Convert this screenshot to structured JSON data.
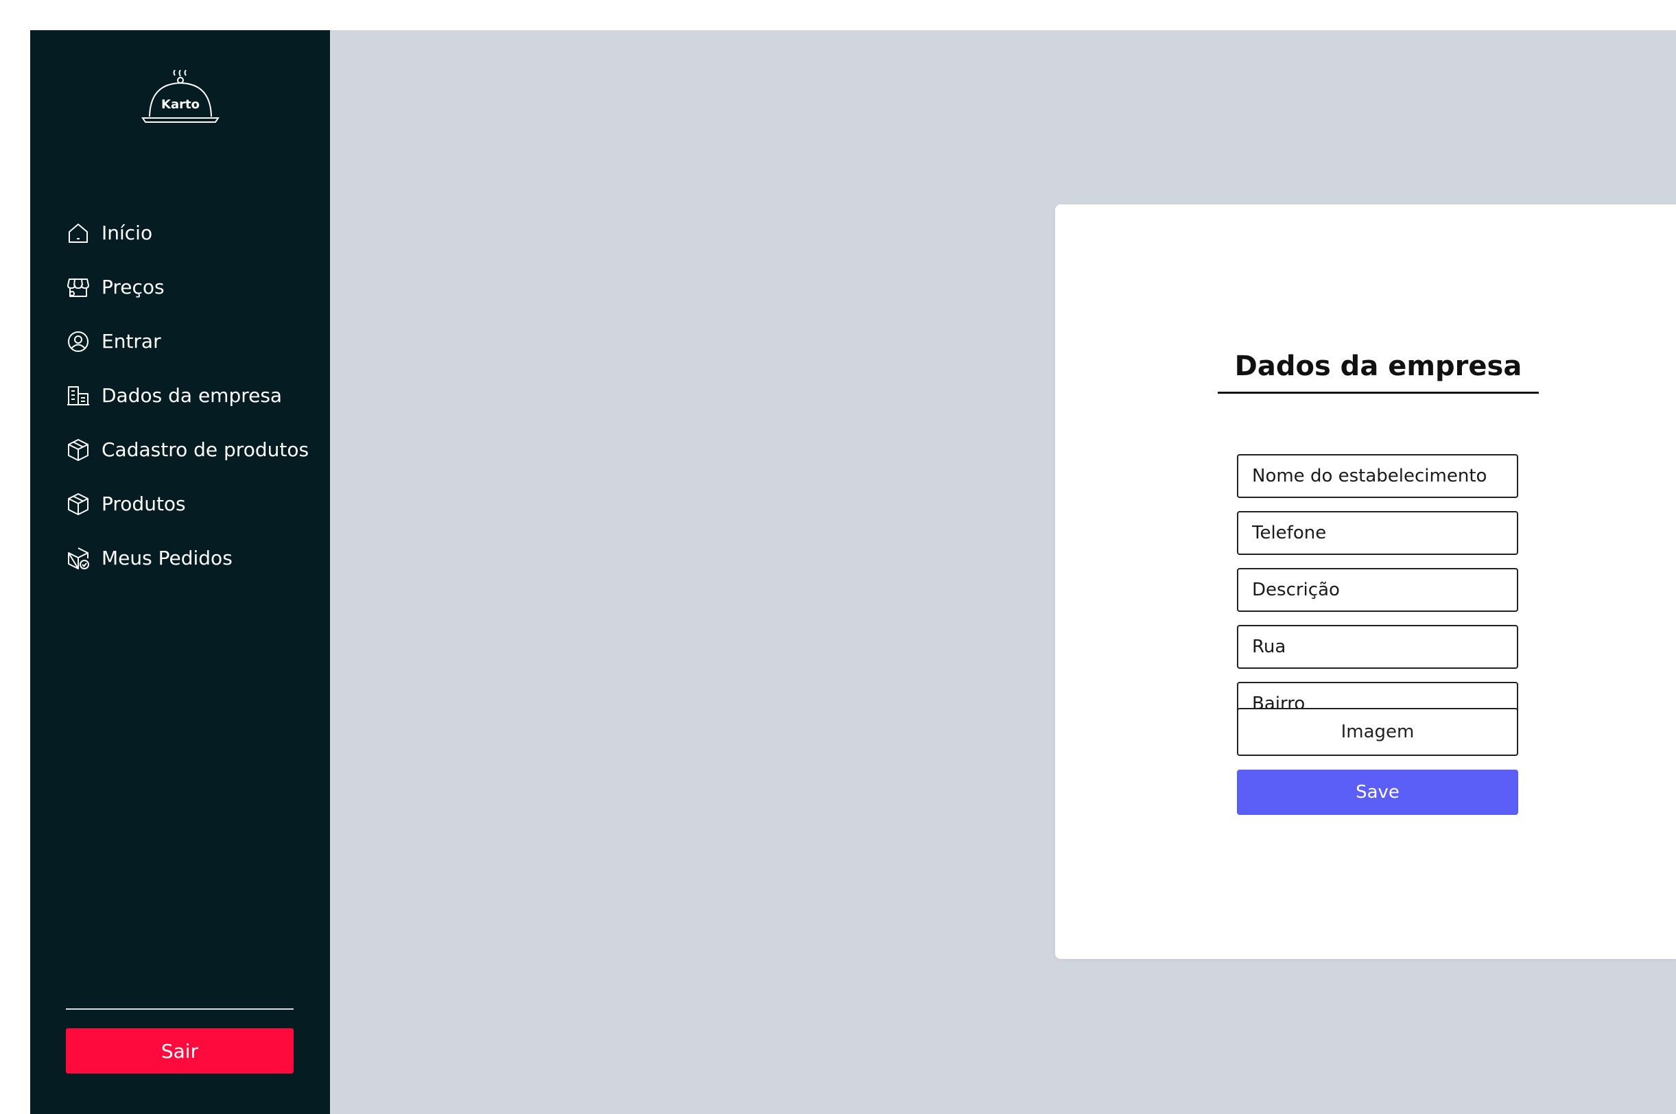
{
  "brand": {
    "name": "Karto"
  },
  "sidebar": {
    "items": [
      {
        "label": "Início",
        "icon": "home-icon"
      },
      {
        "label": "Preços",
        "icon": "storefront-icon"
      },
      {
        "label": "Entrar",
        "icon": "user-circle-icon"
      },
      {
        "label": "Dados da empresa",
        "icon": "buildings-icon"
      },
      {
        "label": "Cadastro de produtos",
        "icon": "package-icon"
      },
      {
        "label": "Produtos",
        "icon": "package-icon"
      },
      {
        "label": "Meus Pedidos",
        "icon": "package-check-icon"
      }
    ],
    "logout_label": "Sair"
  },
  "form": {
    "title": "Dados da empresa",
    "fields": {
      "name_placeholder": "Nome do estabelecimento",
      "phone_placeholder": "Telefone",
      "description_placeholder": "Descrição",
      "street_placeholder": "Rua",
      "neighborhood_placeholder": "Bairro"
    },
    "image_label": "Imagem",
    "save_label": "Save"
  },
  "colors": {
    "sidebar_bg": "#051c22",
    "page_bg": "#d1d5de",
    "save_button": "#5b5ff8",
    "logout_button": "#ff0a3c"
  }
}
